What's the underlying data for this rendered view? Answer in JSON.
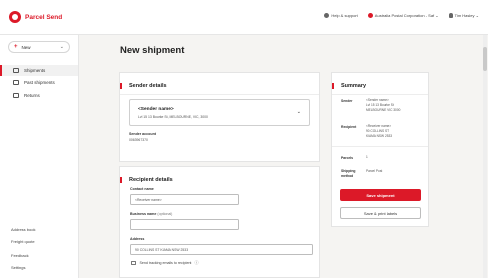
{
  "brand": {
    "name": "Parcel Send",
    "color": "#dc1928"
  },
  "topbar": {
    "help": "Help & support",
    "account": "Australia Postal Corporation - Saf",
    "user": "Tim Hasley"
  },
  "sidebar": {
    "new_label": "New",
    "items": [
      {
        "label": "Shipments",
        "active": true
      },
      {
        "label": "Past shipments",
        "active": false
      },
      {
        "label": "Returns",
        "active": false
      }
    ],
    "bottom_links": [
      "Address book",
      "Freight quote",
      "Feedback",
      "Settings"
    ]
  },
  "main": {
    "title": "New shipment",
    "sender": {
      "heading": "Sender details",
      "name": "<Sender name>",
      "address": "Lvl 15 13 Bourke St, MELBOURNE, VIC, 3000",
      "account_label": "Sender account",
      "account_value": "0063967370"
    },
    "recipient": {
      "heading": "Recipient details",
      "contact_label": "Contact name",
      "contact_value": "<Receiver name>",
      "business_label": "Business name",
      "business_optional": "(optional)",
      "business_value": "",
      "address_label": "Address",
      "address_value": "90 COLLINS ST KIAMA NSW 2533",
      "tracking_label": "Send tracking emails to recipient",
      "tracking_info": "ⓘ"
    }
  },
  "summary": {
    "heading": "Summary",
    "sender_label": "Sender",
    "sender_lines": [
      "<Sender name>",
      "Lvl 15 13 Bourke St",
      "MELBOURNE VIC 3000"
    ],
    "recipient_label": "Recipient",
    "recipient_lines": [
      "<Receiver name>",
      "90 COLLINS ST",
      "KIAMA NSW 2533"
    ],
    "parcels_label": "Parcels",
    "parcels_value": "1",
    "method_label": "Shipping method",
    "method_value": "Parcel Post",
    "save_button": "Save shipment",
    "save_print_button": "Save & print labels"
  }
}
